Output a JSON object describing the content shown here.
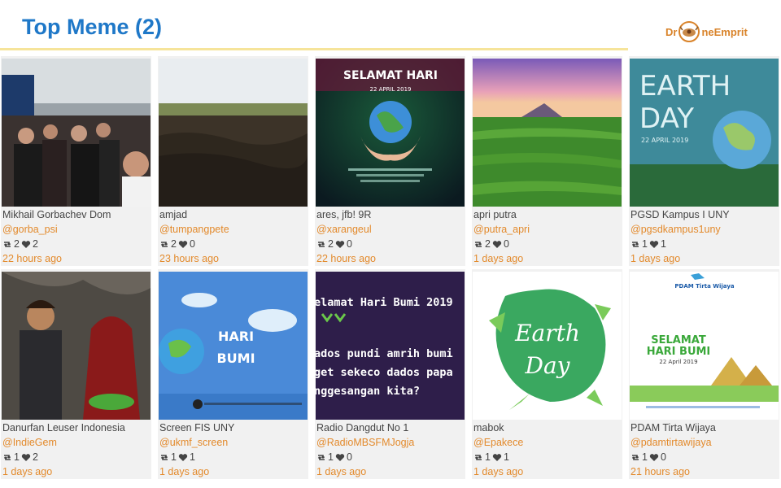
{
  "page": {
    "title": "Top Meme (2)"
  },
  "logo": {
    "text_left": "Dr",
    "text_right": "neEmprit",
    "accent": "#d9832a"
  },
  "colors": {
    "title": "#1f78c8",
    "rule": "#f6e49a",
    "handle": "#e38a2c",
    "card_bg": "#f1f1f1"
  },
  "icons": {
    "retweet": "retweet-icon",
    "like": "heart-icon",
    "logo": "drone-icon"
  },
  "memes": [
    {
      "name": "Mikhail Gorbachev Dom",
      "handle": "@gorba_psi",
      "retweets": "2",
      "likes": "2",
      "time": "22 hours ago",
      "image": "crowd-photo"
    },
    {
      "name": "amjad",
      "handle": "@tumpangpete",
      "retweets": "2",
      "likes": "0",
      "time": "23 hours ago",
      "image": "cleared-land-photo"
    },
    {
      "name": "ares, jfb! 9R",
      "handle": "@xarangeul",
      "retweets": "2",
      "likes": "0",
      "time": "22 hours ago",
      "image": "selamat-hari-bumi-poster",
      "caption": "SELAMAT HARI",
      "caption2": "22 APRIL 2019"
    },
    {
      "name": "apri putra",
      "handle": "@putra_apri",
      "retweets": "2",
      "likes": "0",
      "time": "1 days ago",
      "image": "rice-field-sunset-photo"
    },
    {
      "name": "PGSD Kampus I UNY",
      "handle": "@pgsdkampus1uny",
      "retweets": "1",
      "likes": "1",
      "time": "1 days ago",
      "image": "earth-day-globe-poster",
      "caption": "EARTH",
      "caption2": "DAY",
      "caption3": "22 APRIL 2019"
    },
    {
      "name": "Danurfan Leuser Indonesia",
      "handle": "@IndieGem",
      "retweets": "1",
      "likes": "2",
      "time": "1 days ago",
      "image": "couple-traditional-dress-photo"
    },
    {
      "name": "Screen FIS UNY",
      "handle": "@ukmf_screen",
      "retweets": "1",
      "likes": "1",
      "time": "1 days ago",
      "image": "hari-bumi-video-still",
      "caption": "HARI",
      "caption2": "BUMI"
    },
    {
      "name": "Radio Dangdut No 1",
      "handle": "@RadioMBSFMJogja",
      "retweets": "1",
      "likes": "0",
      "time": "1 days ago",
      "image": "text-poster",
      "line1": "elamat Hari Bumi 2019",
      "line2": "ados pundi amrih bumi",
      "line3": "get sekeco dados papa",
      "line4": "nggesangan kita?"
    },
    {
      "name": "mabok",
      "handle": "@Epakece",
      "retweets": "1",
      "likes": "1",
      "time": "1 days ago",
      "image": "earth-day-lettering",
      "caption": "Earth",
      "caption2": "Day"
    },
    {
      "name": "PDAM Tirta Wijaya",
      "handle": "@pdamtirtawijaya",
      "retweets": "1",
      "likes": "0",
      "time": "21 hours ago",
      "image": "pdam-greeting-poster",
      "caption": "SELAMAT",
      "caption2": "HARI BUMI",
      "caption3": "22 April 2019",
      "caption4": "PDAM Tirta Wijaya"
    }
  ]
}
